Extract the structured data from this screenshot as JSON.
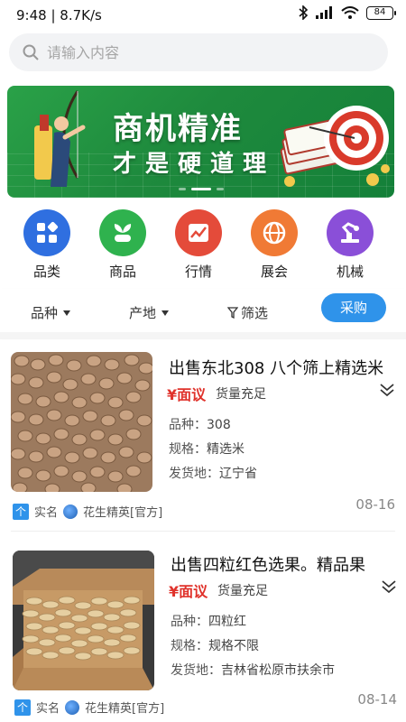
{
  "status_bar": {
    "time_speed": "9:48 | 8.7K/s",
    "battery": "84"
  },
  "search": {
    "placeholder": "请输入内容"
  },
  "banner": {
    "line1": "商机精准",
    "line2": "才是硬道理"
  },
  "categories": [
    {
      "label": "品类",
      "color": "#2f6fe0",
      "icon": "grid-icon"
    },
    {
      "label": "商品",
      "color": "#2fb24e",
      "icon": "sprout-icon"
    },
    {
      "label": "行情",
      "color": "#e44b3a",
      "icon": "trend-chart-icon"
    },
    {
      "label": "展会",
      "color": "#f07a35",
      "icon": "globe-icon"
    },
    {
      "label": "机械",
      "color": "#8a4fd8",
      "icon": "machine-arm-icon"
    }
  ],
  "filters": {
    "variety": "品种",
    "origin": "产地",
    "filter": "筛选",
    "buy": "采购"
  },
  "listings": [
    {
      "title": "出售东北308 八个筛上精选米",
      "price": "¥面议",
      "stock": "货量充足",
      "attr1_k": "品种：",
      "attr1_v": "308",
      "attr2_k": "规格：",
      "attr2_v": "精选米",
      "attr3_k": "发货地：",
      "attr3_v": "辽宁省",
      "verified": "实名",
      "seller": "花生精英[官方]",
      "date": "08-16"
    },
    {
      "title": "出售四粒红色选果。精品果",
      "price": "¥面议",
      "stock": "货量充足",
      "attr1_k": "品种：",
      "attr1_v": "四粒红",
      "attr2_k": "规格：",
      "attr2_v": "规格不限",
      "attr3_k": "发货地：",
      "attr3_v": "吉林省松原市扶余市",
      "verified": "实名",
      "seller": "花生精英[官方]",
      "date": "08-14"
    }
  ],
  "colors": {
    "accent": "#2f93ea",
    "price": "#e0322b",
    "banner": "#1e8a3d"
  }
}
